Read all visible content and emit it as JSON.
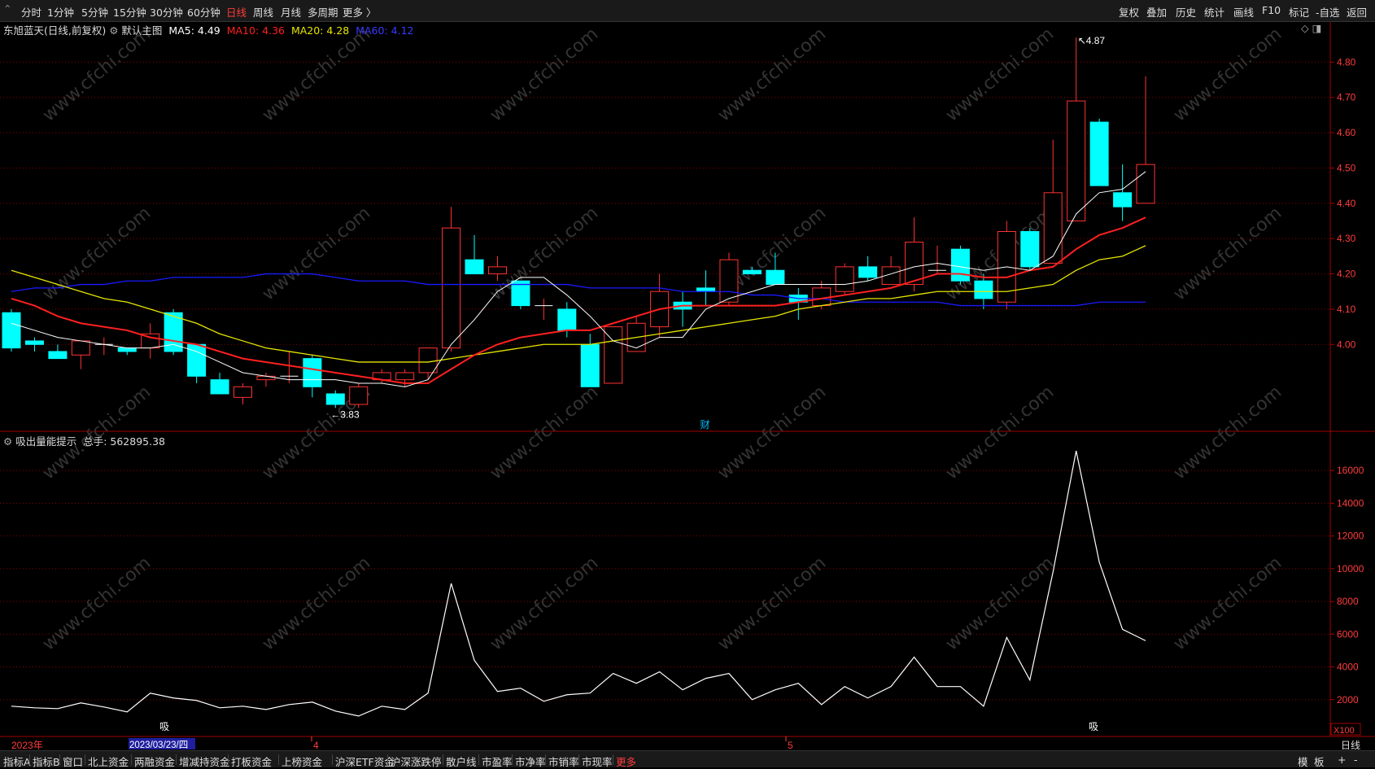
{
  "toolbar": {
    "left_items": [
      "分时",
      "1分钟",
      "5分钟",
      "15分钟",
      "30分钟",
      "60分钟",
      "日线",
      "周线",
      "月线",
      "多周期",
      "更多 〉"
    ],
    "active": "日线",
    "right_items": [
      "复权",
      "叠加",
      "历史",
      "统计",
      "画线",
      "F10",
      "标记",
      "-自选",
      "返回"
    ]
  },
  "main_panel": {
    "stock_title": "东旭蓝天(日线,前复权)",
    "chart_label": "默认主图",
    "ma5": "MA5: 4.49",
    "ma10": "MA10: 4.36",
    "ma20": "MA20: 4.28",
    "ma60": "MA60: 4.12",
    "high_label": "4.87",
    "low_label": "3.83",
    "marker_cai": "财",
    "y_ticks": [
      "4.80",
      "4.70",
      "4.60",
      "4.50",
      "4.40",
      "4.30",
      "4.20",
      "4.10",
      "4.00"
    ]
  },
  "sub_panel": {
    "indicator_label": "吸出量能提示",
    "total_hands": "总手: 562895.38",
    "y_ticks": [
      "16000",
      "14000",
      "12000",
      "10000",
      "8000",
      "6000",
      "4000",
      "2000"
    ],
    "unit": "X100",
    "marks": [
      "吸",
      "吸"
    ]
  },
  "x_axis": {
    "labels": [
      "2023年",
      "2023/03/23/四",
      "4",
      "5"
    ],
    "right_label": "日线"
  },
  "bottom_tabs": {
    "items": [
      "指标A",
      "指标B",
      "窗口",
      "北上资金",
      "两融资金",
      "增减持资金",
      "打板资金",
      "上榜资金",
      "沪深ETF资金",
      "沪深涨跌停",
      "散户线",
      "市盈率",
      "市净率",
      "市销率",
      "市现率",
      "更多"
    ],
    "active": "更多",
    "right_items": [
      "模",
      "板",
      "+",
      "-"
    ]
  },
  "watermark": "www.cfchi.com",
  "colors": {
    "up": "#ff3232",
    "down": "#00ffff",
    "ma5": "#ffffff",
    "ma10": "#ff2020",
    "ma20": "#e6e600",
    "ma60": "#1a1aff",
    "grid": "#8b0000",
    "axis_text": "#ff3b3b"
  },
  "chart_data": {
    "type": "candlestick",
    "candles": [
      {
        "o": 4.09,
        "h": 4.1,
        "l": 3.98,
        "c": 3.99
      },
      {
        "o": 4.01,
        "h": 4.02,
        "l": 3.98,
        "c": 4.0
      },
      {
        "o": 3.98,
        "h": 4.0,
        "l": 3.96,
        "c": 3.96
      },
      {
        "o": 3.97,
        "h": 4.01,
        "l": 3.93,
        "c": 4.01
      },
      {
        "o": 4.0,
        "h": 4.02,
        "l": 3.97,
        "c": 4.0
      },
      {
        "o": 3.99,
        "h": 3.99,
        "l": 3.97,
        "c": 3.98
      },
      {
        "o": 3.99,
        "h": 4.06,
        "l": 3.96,
        "c": 4.03
      },
      {
        "o": 4.09,
        "h": 4.1,
        "l": 3.97,
        "c": 3.98
      },
      {
        "o": 4.0,
        "h": 4.0,
        "l": 3.89,
        "c": 3.91
      },
      {
        "o": 3.9,
        "h": 3.92,
        "l": 3.86,
        "c": 3.86
      },
      {
        "o": 3.85,
        "h": 3.89,
        "l": 3.83,
        "c": 3.88
      },
      {
        "o": 3.9,
        "h": 3.92,
        "l": 3.88,
        "c": 3.91
      },
      {
        "o": 3.91,
        "h": 3.98,
        "l": 3.89,
        "c": 3.91
      },
      {
        "o": 3.96,
        "h": 3.97,
        "l": 3.85,
        "c": 3.88
      },
      {
        "o": 3.86,
        "h": 3.87,
        "l": 3.82,
        "c": 3.83
      },
      {
        "o": 3.83,
        "h": 3.89,
        "l": 3.82,
        "c": 3.88
      },
      {
        "o": 3.9,
        "h": 3.93,
        "l": 3.89,
        "c": 3.92
      },
      {
        "o": 3.9,
        "h": 3.93,
        "l": 3.88,
        "c": 3.92
      },
      {
        "o": 3.92,
        "h": 3.98,
        "l": 3.9,
        "c": 3.99
      },
      {
        "o": 3.99,
        "h": 4.39,
        "l": 3.98,
        "c": 4.33
      },
      {
        "o": 4.24,
        "h": 4.31,
        "l": 4.2,
        "c": 4.2
      },
      {
        "o": 4.2,
        "h": 4.25,
        "l": 4.18,
        "c": 4.22
      },
      {
        "o": 4.18,
        "h": 4.18,
        "l": 4.1,
        "c": 4.11
      },
      {
        "o": 4.11,
        "h": 4.13,
        "l": 4.07,
        "c": 4.11
      },
      {
        "o": 4.1,
        "h": 4.12,
        "l": 4.02,
        "c": 4.04
      },
      {
        "o": 4.0,
        "h": 4.03,
        "l": 3.88,
        "c": 3.88
      },
      {
        "o": 3.89,
        "h": 4.05,
        "l": 3.89,
        "c": 4.05
      },
      {
        "o": 3.98,
        "h": 4.08,
        "l": 3.98,
        "c": 4.06
      },
      {
        "o": 4.05,
        "h": 4.2,
        "l": 4.02,
        "c": 4.15
      },
      {
        "o": 4.12,
        "h": 4.15,
        "l": 4.05,
        "c": 4.1
      },
      {
        "o": 4.16,
        "h": 4.21,
        "l": 4.11,
        "c": 4.15
      },
      {
        "o": 4.12,
        "h": 4.26,
        "l": 4.11,
        "c": 4.24
      },
      {
        "o": 4.21,
        "h": 4.22,
        "l": 4.2,
        "c": 4.2
      },
      {
        "o": 4.21,
        "h": 4.26,
        "l": 4.17,
        "c": 4.17
      },
      {
        "o": 4.14,
        "h": 4.16,
        "l": 4.07,
        "c": 4.12
      },
      {
        "o": 4.11,
        "h": 4.18,
        "l": 4.1,
        "c": 4.16
      },
      {
        "o": 4.15,
        "h": 4.23,
        "l": 4.14,
        "c": 4.22
      },
      {
        "o": 4.22,
        "h": 4.25,
        "l": 4.18,
        "c": 4.19
      },
      {
        "o": 4.17,
        "h": 4.25,
        "l": 4.17,
        "c": 4.22
      },
      {
        "o": 4.17,
        "h": 4.36,
        "l": 4.15,
        "c": 4.29
      },
      {
        "o": 4.21,
        "h": 4.28,
        "l": 4.2,
        "c": 4.21
      },
      {
        "o": 4.27,
        "h": 4.28,
        "l": 4.17,
        "c": 4.18
      },
      {
        "o": 4.18,
        "h": 4.2,
        "l": 4.1,
        "c": 4.13
      },
      {
        "o": 4.12,
        "h": 4.35,
        "l": 4.1,
        "c": 4.32
      },
      {
        "o": 4.32,
        "h": 4.33,
        "l": 4.21,
        "c": 4.22
      },
      {
        "o": 4.23,
        "h": 4.58,
        "l": 4.23,
        "c": 4.43
      },
      {
        "o": 4.35,
        "h": 4.87,
        "l": 4.35,
        "c": 4.69
      },
      {
        "o": 4.63,
        "h": 4.64,
        "l": 4.45,
        "c": 4.45
      },
      {
        "o": 4.43,
        "h": 4.51,
        "l": 4.35,
        "c": 4.39
      },
      {
        "o": 4.4,
        "h": 4.76,
        "l": 4.4,
        "c": 4.51
      }
    ],
    "ma5": [
      4.06,
      4.04,
      4.02,
      4.01,
      4.0,
      3.99,
      3.99,
      4.0,
      3.98,
      3.95,
      3.92,
      3.91,
      3.9,
      3.9,
      3.9,
      3.89,
      3.89,
      3.88,
      3.9,
      4.0,
      4.07,
      4.15,
      4.19,
      4.19,
      4.14,
      4.08,
      4.01,
      3.99,
      4.02,
      4.02,
      4.1,
      4.13,
      4.15,
      4.17,
      4.17,
      4.17,
      4.17,
      4.18,
      4.2,
      4.22,
      4.23,
      4.22,
      4.21,
      4.22,
      4.21,
      4.25,
      4.37,
      4.43,
      4.44,
      4.49
    ],
    "ma10": [
      4.13,
      4.11,
      4.08,
      4.06,
      4.05,
      4.04,
      4.02,
      4.01,
      4.0,
      3.98,
      3.96,
      3.95,
      3.94,
      3.93,
      3.92,
      3.91,
      3.9,
      3.89,
      3.89,
      3.93,
      3.97,
      4.0,
      4.02,
      4.03,
      4.04,
      4.04,
      4.06,
      4.08,
      4.1,
      4.11,
      4.11,
      4.11,
      4.11,
      4.11,
      4.12,
      4.13,
      4.14,
      4.15,
      4.16,
      4.18,
      4.2,
      4.2,
      4.19,
      4.19,
      4.21,
      4.22,
      4.27,
      4.31,
      4.33,
      4.36
    ],
    "ma20": [
      4.21,
      4.19,
      4.17,
      4.15,
      4.13,
      4.12,
      4.1,
      4.08,
      4.06,
      4.03,
      4.01,
      3.99,
      3.98,
      3.97,
      3.96,
      3.95,
      3.95,
      3.95,
      3.95,
      3.96,
      3.97,
      3.98,
      3.99,
      4.0,
      4.0,
      4.0,
      4.01,
      4.02,
      4.03,
      4.04,
      4.05,
      4.06,
      4.07,
      4.08,
      4.1,
      4.11,
      4.12,
      4.13,
      4.13,
      4.14,
      4.15,
      4.15,
      4.15,
      4.15,
      4.16,
      4.17,
      4.21,
      4.24,
      4.25,
      4.28
    ],
    "ma60": [
      4.15,
      4.16,
      4.16,
      4.17,
      4.17,
      4.18,
      4.18,
      4.19,
      4.19,
      4.19,
      4.19,
      4.2,
      4.2,
      4.2,
      4.19,
      4.18,
      4.18,
      4.18,
      4.17,
      4.17,
      4.17,
      4.17,
      4.17,
      4.17,
      4.17,
      4.16,
      4.16,
      4.16,
      4.16,
      4.15,
      4.15,
      4.15,
      4.14,
      4.14,
      4.13,
      4.13,
      4.12,
      4.12,
      4.12,
      4.12,
      4.12,
      4.11,
      4.11,
      4.11,
      4.11,
      4.11,
      4.11,
      4.12,
      4.12,
      4.12
    ],
    "volume_line": [
      1600,
      1500,
      1450,
      1800,
      1550,
      1250,
      2400,
      2100,
      1950,
      1500,
      1600,
      1400,
      1700,
      1850,
      1300,
      1000,
      1600,
      1400,
      2400,
      9100,
      4400,
      2500,
      2700,
      1900,
      2300,
      2400,
      3600,
      3000,
      3700,
      2600,
      3300,
      3600,
      2000,
      2600,
      3000,
      1700,
      2800,
      2100,
      2800,
      4600,
      2800,
      2800,
      1600,
      5800,
      3200,
      9800,
      17200,
      10400,
      6300,
      5600
    ],
    "price_ylim": [
      3.8,
      4.9
    ],
    "volume_ylim": [
      0,
      17500
    ]
  }
}
